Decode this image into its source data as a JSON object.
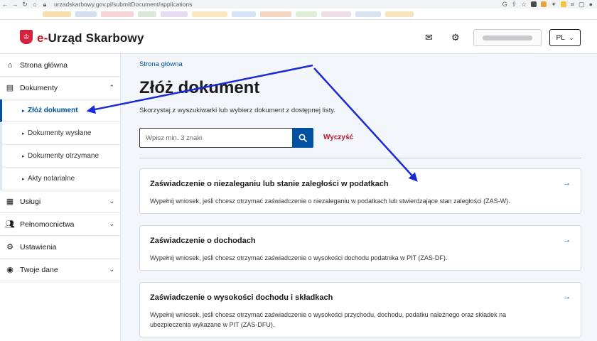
{
  "browser": {
    "url": "urzadskarbowy.gov.pl/submitDocument/applications"
  },
  "header": {
    "brand_prefix": "e-",
    "brand_name": "Urząd Skarbowy",
    "language": "PL"
  },
  "sidebar": {
    "items": [
      {
        "label": "Strona główna",
        "icon": "home-icon"
      },
      {
        "label": "Dokumenty",
        "icon": "document-icon",
        "expanded": true
      },
      {
        "label": "Złóż dokument",
        "sub": true,
        "active": true
      },
      {
        "label": "Dokumenty wysłane",
        "sub": true
      },
      {
        "label": "Dokumenty otrzymane",
        "sub": true
      },
      {
        "label": "Akty notarialne",
        "sub": true
      },
      {
        "label": "Usługi",
        "icon": "services-icon"
      },
      {
        "label": "Pełnomocnictwa",
        "icon": "users-icon"
      },
      {
        "label": "Ustawienia",
        "icon": "gear-icon"
      },
      {
        "label": "Twoje dane",
        "icon": "user-icon"
      }
    ]
  },
  "main": {
    "breadcrumb": "Strona główna",
    "title": "Złóż dokument",
    "intro": "Skorzystaj z wyszukiwarki lub wybierz dokument z dostępnej listy.",
    "search": {
      "placeholder": "Wpisz min. 3 znaki",
      "clear_label": "Wyczyść"
    },
    "cards": [
      {
        "title": "Zaświadczenie o niezaleganiu lub stanie zaległości w podatkach",
        "description": "Wypełnij wniosek, jeśli chcesz otrzymać zaświadczenie o niezaleganiu w podatkach lub stwierdzające stan zaległości (ZAS-W)."
      },
      {
        "title": "Zaświadczenie o dochodach",
        "description": "Wypełnij wniosek, jeśli chcesz otrzymać zaświadczenie o wysokości dochodu podatnika w PIT (ZAS-DF)."
      },
      {
        "title": "Zaświadczenie o wysokości dochodu i składkach",
        "description": "Wypełnij wniosek, jeśli chcesz otrzymać zaświadczenie o wysokości przychodu, dochodu, podatku należnego oraz składek na ubezpieczenia wykazane w PIT (ZAS-DFU)."
      }
    ]
  },
  "colors": {
    "accent": "#0050a0",
    "danger": "#b3152a",
    "annotation": "#1a2ad6"
  }
}
